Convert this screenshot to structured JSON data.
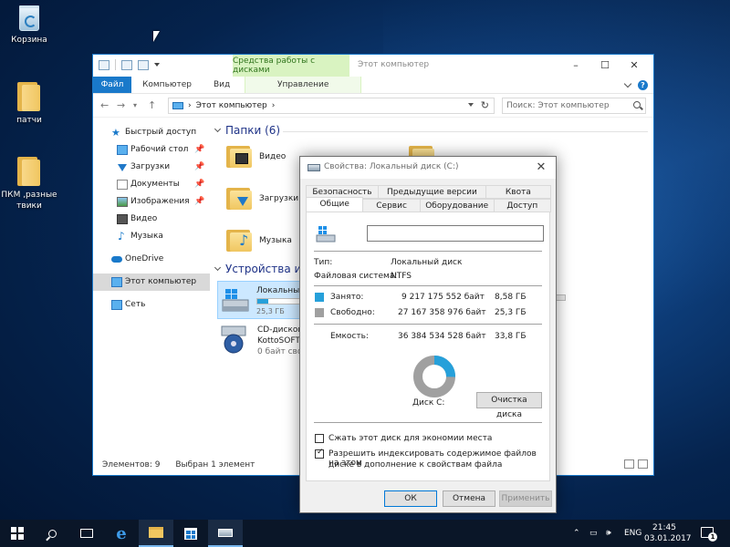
{
  "desktop": {
    "icons": [
      {
        "label": "Корзина"
      },
      {
        "label": "патчи"
      },
      {
        "label": "ПКМ ,разные твики"
      }
    ]
  },
  "explorer": {
    "ribbon_context_group": "Средства работы с дисками",
    "window_title": "Этот компьютер",
    "tabs": [
      "Файл",
      "Компьютер",
      "Вид",
      "Управление"
    ],
    "address_path": "Этот компьютер",
    "search_placeholder": "Поиск: Этот компьютер",
    "nav": {
      "quick_access": "Быстрый доступ",
      "items": [
        "Рабочий стол",
        "Загрузки",
        "Документы",
        "Изображения",
        "Видео",
        "Музыка"
      ],
      "onedrive": "OneDrive",
      "this_pc": "Этот компьютер",
      "network": "Сеть"
    },
    "folders_header": "Папки (6)",
    "folders": [
      "Видео",
      "Загрузки",
      "Музыка"
    ],
    "devices_header": "Устройства и ди",
    "drive": {
      "name": "Локальны",
      "free": "25,3 ГБ",
      "used_fraction": 0.24
    },
    "cd": {
      "line1": "CD-дисков",
      "line2": "KottoSOFT",
      "line3": "0 байт сво"
    },
    "status": {
      "items": "Элементов: 9",
      "selected": "Выбран 1 элемент"
    }
  },
  "dialog": {
    "title": "Свойства: Локальный диск (C:)",
    "tabs_row1": [
      "Безопасность",
      "Предыдущие версии",
      "Квота"
    ],
    "tabs_row2": [
      "Общие",
      "Сервис",
      "Оборудование",
      "Доступ"
    ],
    "type_label": "Тип:",
    "type_value": "Локальный диск",
    "fs_label": "Файловая система:",
    "fs_value": "NTFS",
    "used_label": "Занято:",
    "used_bytes": "9 217 175 552 байт",
    "used_gb": "8,58 ГБ",
    "free_label": "Свободно:",
    "free_bytes": "27 167 358 976 байт",
    "free_gb": "25,3 ГБ",
    "capacity_label": "Емкость:",
    "capacity_bytes": "36 384 534 528 байт",
    "capacity_gb": "33,8 ГБ",
    "used_fraction": 0.2533,
    "disk_label": "Диск C:",
    "cleanup_button": "Очистка диска",
    "compress_checkbox": "Сжать этот диск для экономии места",
    "index_checkbox_line1": "Разрешить индексировать содержимое файлов на этом",
    "index_checkbox_line2": "диске в дополнение к свойствам файла",
    "ok": "ОК",
    "cancel": "Отмена",
    "apply": "Применить",
    "colors": {
      "used": "#26a0da",
      "free": "#a0a0a0"
    }
  },
  "taskbar": {
    "lang": "ENG",
    "time": "21:45",
    "date": "03.01.2017",
    "notifications": "1"
  }
}
